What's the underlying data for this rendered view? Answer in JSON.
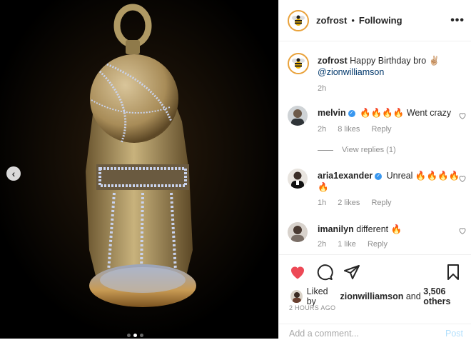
{
  "post": {
    "author": "zofrost",
    "follow_status": "Following",
    "separator": "•",
    "more": "•••"
  },
  "media": {
    "prev_arrow": "‹",
    "dots": 3,
    "active_dot": 1
  },
  "caption": {
    "user": "zofrost",
    "text": "Happy Birthday bro ✌🏼",
    "mention": "@zionwilliamson",
    "time": "2h"
  },
  "comments": [
    {
      "user": "melvin",
      "verified": true,
      "text": "🔥🔥🔥🔥 Went crazy",
      "time": "2h",
      "likes": "8 likes",
      "reply": "Reply",
      "view_replies": "View replies (1)"
    },
    {
      "user": "aria1exander",
      "verified": true,
      "text": "Unreal 🔥🔥🔥🔥🔥",
      "time": "1h",
      "likes": "2 likes",
      "reply": "Reply"
    },
    {
      "user": "imanilyn",
      "verified": false,
      "text": "different 🔥",
      "time": "2h",
      "likes": "1 like",
      "reply": "Reply"
    }
  ],
  "likes_line": {
    "prefix": "Liked by",
    "user": "zionwilliamson",
    "and": "and",
    "others": "3,506 others"
  },
  "timestamp": "2 HOURS AGO",
  "add_comment": {
    "placeholder": "Add a comment...",
    "post_label": "Post"
  },
  "icons": {
    "like": "heart-icon",
    "comment": "comment-icon",
    "share": "paper-plane-icon",
    "save": "bookmark-icon"
  },
  "colors": {
    "like_red": "#ed4956",
    "verified_blue": "#3897f0",
    "mention": "#00376b",
    "post_disabled": "#b2dffc"
  }
}
